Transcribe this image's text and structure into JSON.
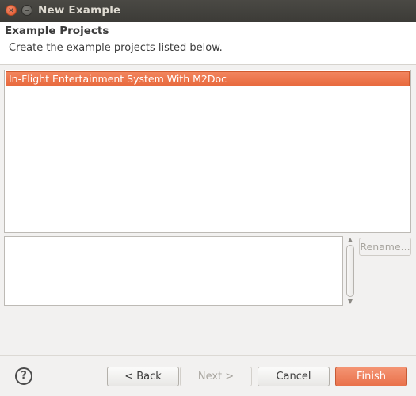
{
  "window": {
    "title": "New Example"
  },
  "header": {
    "title": "Example Projects",
    "description": "Create the example projects listed below."
  },
  "project_list": {
    "items": [
      {
        "label": "In-Flight Entertainment System With M2Doc",
        "selected": true
      }
    ]
  },
  "description_box": {
    "value": ""
  },
  "rename_button": {
    "label": "Rename...",
    "enabled": false
  },
  "footer": {
    "help_icon_glyph": "?",
    "back_label": "< Back",
    "next_label": "Next >",
    "cancel_label": "Cancel",
    "finish_label": "Finish"
  },
  "colors": {
    "accent": "#e9714a",
    "titlebar": "#3c3b37",
    "selection": "#ed7a4f"
  }
}
